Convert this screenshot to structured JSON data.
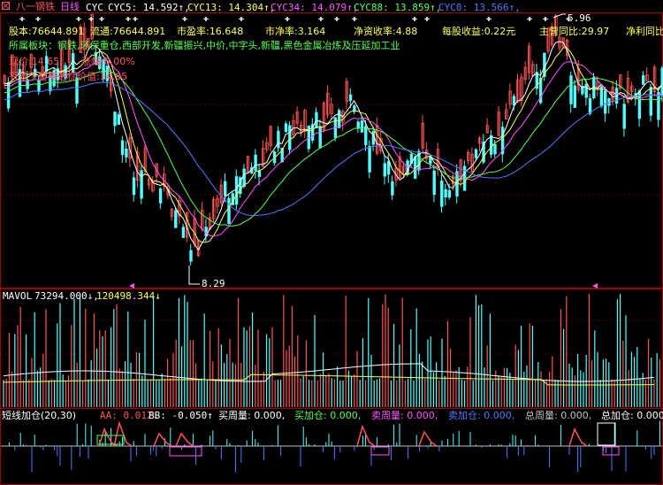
{
  "colors": {
    "background": "#000000",
    "up_candle": "#ff5454",
    "down_candle": "#54ffff",
    "frame": "#a00000",
    "yellow": "#ffff54",
    "white": "#ffffff",
    "magenta": "#ff54ff",
    "green": "#54ff54",
    "blue": "#5478ff",
    "gray": "#c0c0c0"
  },
  "header": {
    "stock_name": "八一钢铁",
    "period": "日线",
    "indicator": "CYC",
    "cyc5": "CYC5: 14.592↑,",
    "cyc13": "CYC13: 14.304↑,",
    "cyc34": "CYC34: 14.079↑,",
    "cyc88": "CYC88: 13.859↑,",
    "cyc0": "CYC0: 13.566↑,"
  },
  "info": {
    "total_shares": "股本:76644.891",
    "float_shares": "流通:76644.891",
    "pe_ratio": "市盈率:16.648",
    "pb_ratio": "市净率:3.164",
    "roe": "净资收率:4.88",
    "eps": "每股收益:0.22元",
    "revenue_yoy": "主营同比:29.97",
    "profit_yoy": "净利同比",
    "sectors": "所属板块：钢铁,环保重仓,西部开发,新疆振兴,中价,中字头,新疆,黑色金属冶炼及压延加工业",
    "current_price": "现价:14.65",
    "change": "涨幅:0.00%",
    "target_note": "有效下财务达标价值:14.65"
  },
  "main_chart": {
    "high_label": "5.96",
    "low_label": "8.29"
  },
  "volume_panel": {
    "title": "MAVOL",
    "ma1": "73294.000↓,",
    "ma2": "120498.344↓"
  },
  "bottom_panel": {
    "title": "短线加仓(20,30)",
    "aa": "AA: 0.012↓",
    "bb": "BB: -0.050↑",
    "buy_cycle_label": "买周量: 0.000,",
    "buy_add_label": "买加仓: 0.000,",
    "sell_cycle_label": "卖周量: 0.000,",
    "sell_add_label": "卖加仓: 0.000,",
    "total_cycle_label": "总周量: 0.000,",
    "total_add_label": "总加仓: 0.000,"
  }
}
